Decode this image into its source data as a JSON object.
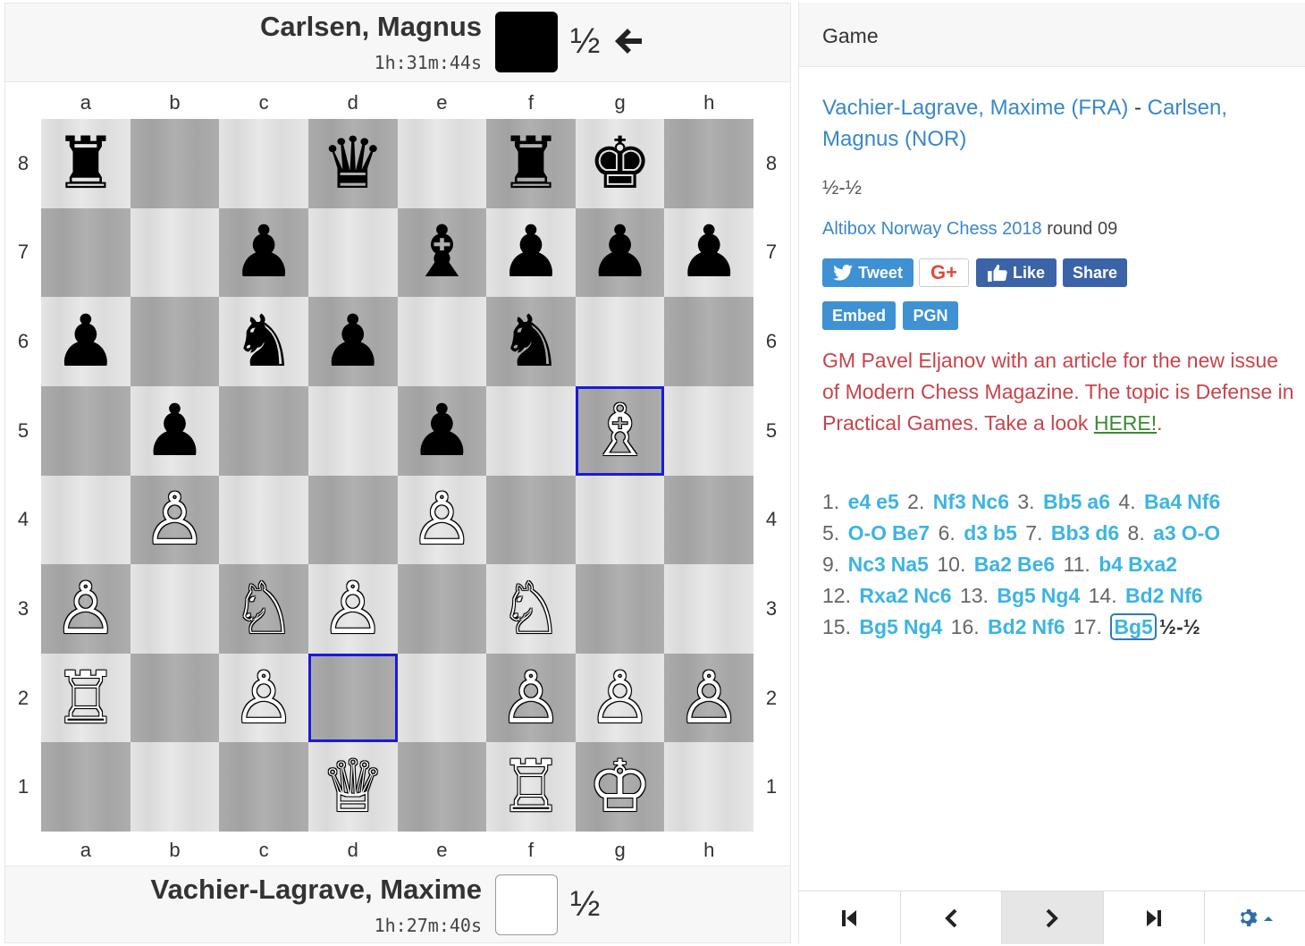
{
  "top_player": {
    "name": "Carlsen, Magnus",
    "clock": "1h:31m:44s",
    "score": "½",
    "color": "black"
  },
  "bottom_player": {
    "name": "Vachier-Lagrave, Maxime",
    "clock": "1h:27m:40s",
    "score": "½",
    "color": "white"
  },
  "board": {
    "files": [
      "a",
      "b",
      "c",
      "d",
      "e",
      "f",
      "g",
      "h"
    ],
    "ranks": [
      "8",
      "7",
      "6",
      "5",
      "4",
      "3",
      "2",
      "1"
    ],
    "position": [
      [
        "bR",
        "",
        "",
        "bQ",
        "",
        "bR",
        "bK",
        ""
      ],
      [
        "",
        "",
        "bP",
        "",
        "bB",
        "bP",
        "bP",
        "bP"
      ],
      [
        "bP",
        "",
        "bN",
        "bP",
        "",
        "bN",
        "",
        ""
      ],
      [
        "",
        "bP",
        "",
        "",
        "bP",
        "",
        "wB",
        ""
      ],
      [
        "",
        "wP",
        "",
        "",
        "wP",
        "",
        "",
        ""
      ],
      [
        "wP",
        "",
        "wN",
        "wP",
        "",
        "wN",
        "",
        ""
      ],
      [
        "wR",
        "",
        "wP",
        "",
        "",
        "wP",
        "wP",
        "wP"
      ],
      [
        "",
        "",
        "",
        "wQ",
        "",
        "wR",
        "wK",
        ""
      ]
    ],
    "highlighted_squares": [
      "g5",
      "d2"
    ],
    "glyphs": {
      "wK": "♔",
      "wQ": "♕",
      "wR": "♖",
      "wB": "♗",
      "wN": "♘",
      "wP": "♙",
      "bK": "♚",
      "bQ": "♛",
      "bR": "♜",
      "bB": "♝",
      "bN": "♞",
      "bP": "♟"
    }
  },
  "game": {
    "header": "Game",
    "white_name": "Vachier-Lagrave, Maxime (FRA)",
    "separator": " - ",
    "black_name": "Carlsen, Magnus (NOR)",
    "result": "½-½",
    "event": "Altibox Norway Chess 2018",
    "round": " round 09",
    "buttons": {
      "tweet": "Tweet",
      "gplus": "G+",
      "like": "Like",
      "share": "Share",
      "embed": "Embed",
      "pgn": "PGN"
    },
    "promo_text": "GM Pavel Eljanov with an article for the new issue of Modern Chess Magazine. The topic is Defense in Practical Games. Take a look ",
    "promo_link": "HERE!",
    "promo_end": ".",
    "moves": [
      [
        "1.",
        "e4",
        "e5"
      ],
      [
        "2.",
        "Nf3",
        "Nc6"
      ],
      [
        "3.",
        "Bb5",
        "a6"
      ],
      [
        "4.",
        "Ba4",
        "Nf6"
      ],
      [
        "5.",
        "O-O",
        "Be7"
      ],
      [
        "6.",
        "d3",
        "b5"
      ],
      [
        "7.",
        "Bb3",
        "d6"
      ],
      [
        "8.",
        "a3",
        "O-O"
      ],
      [
        "9.",
        "Nc3",
        "Na5"
      ],
      [
        "10.",
        "Ba2",
        "Be6"
      ],
      [
        "11.",
        "b4",
        "Bxa2"
      ],
      [
        "12.",
        "Rxa2",
        "Nc6"
      ],
      [
        "13.",
        "Bg5",
        "Ng4"
      ],
      [
        "14.",
        "Bd2",
        "Nf6"
      ],
      [
        "15.",
        "Bg5",
        "Ng4"
      ],
      [
        "16.",
        "Bd2",
        "Nf6"
      ],
      [
        "17.",
        "Bg5",
        ""
      ]
    ],
    "current_move": "17. Bg5",
    "final_result": "½-½",
    "nav": [
      "first",
      "previous",
      "next",
      "last",
      "settings"
    ]
  },
  "colors": {
    "link": "#3a87c9",
    "move": "#3db4e2",
    "promo": "#c9434b",
    "highlight": "#1a1adb"
  }
}
